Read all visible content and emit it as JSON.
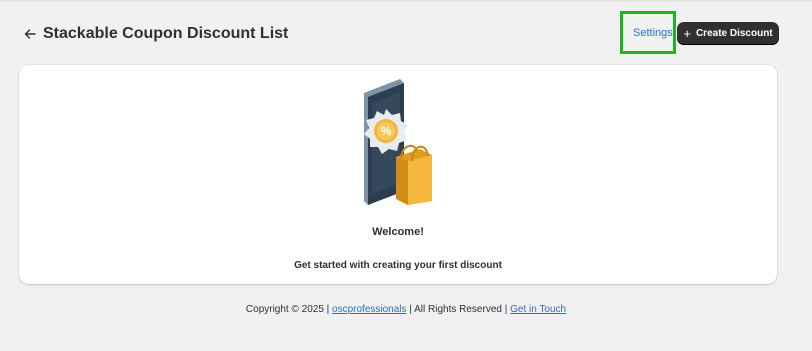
{
  "header": {
    "title": "Stackable Coupon Discount List",
    "settings_label": "Settings",
    "create_label": "Create Discount",
    "create_icon": "+"
  },
  "card": {
    "illustration_icon": "coupon-phone-shopping-bag-icon",
    "badge_symbol": "%",
    "welcome": "Welcome!",
    "subtext": "Get started with creating your first discount"
  },
  "footer": {
    "prefix": "Copyright © 2025 |",
    "company_link": "oscprofessionals",
    "middle": "| All Rights Reserved |",
    "contact_link": "Get in Touch"
  },
  "colors": {
    "accent_highlight": "#1fb31f",
    "link": "#2c6ecb",
    "primary_button": "#303030",
    "phone": "#2b3f4f",
    "bag": "#f5b73b"
  }
}
